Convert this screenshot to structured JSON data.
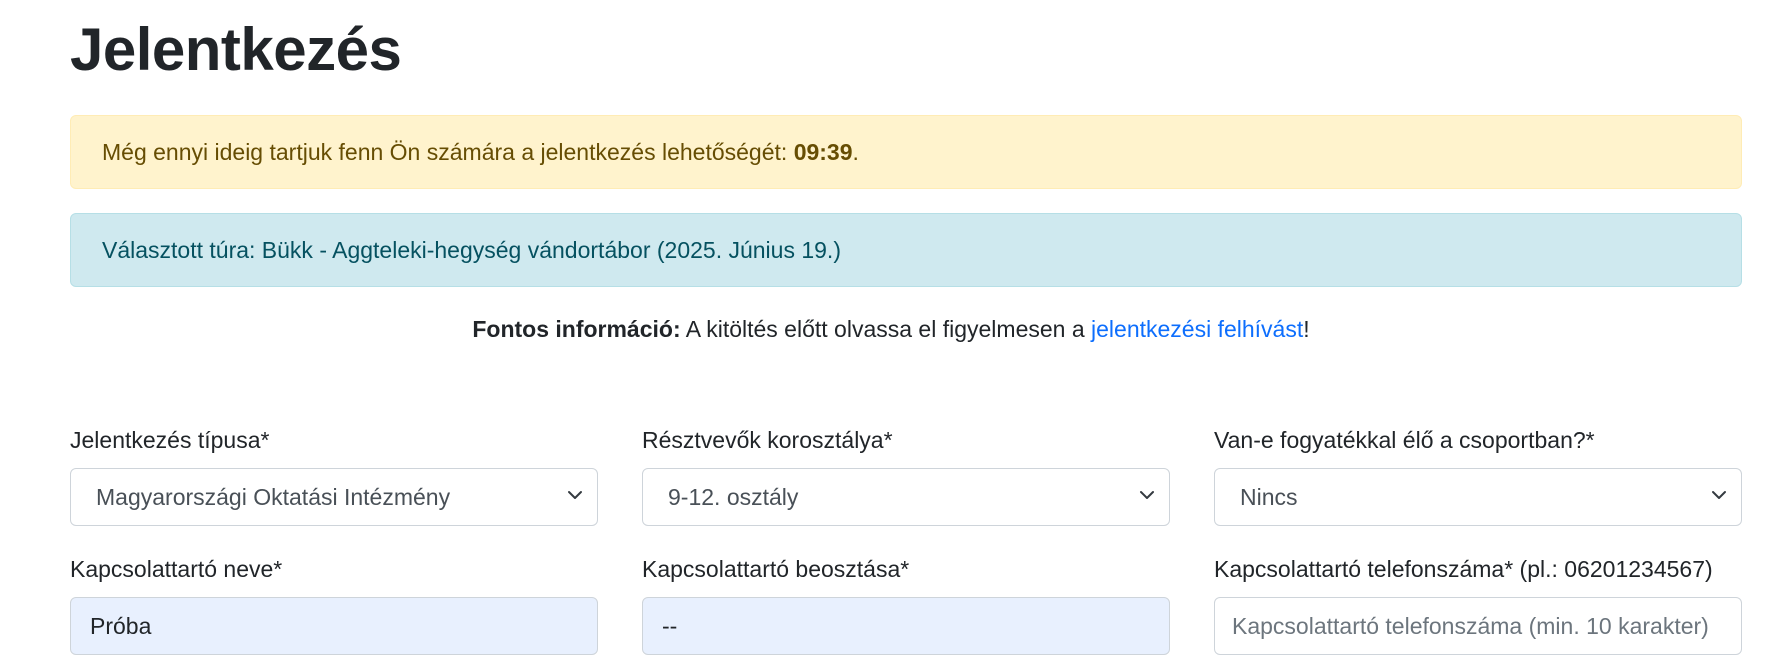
{
  "page": {
    "title": "Jelentkezés"
  },
  "alerts": {
    "timer_text": "Még ennyi ideig tartjuk fenn Ön számára a jelentkezés lehetőségét: ",
    "timer_value": "09:39",
    "timer_suffix": ".",
    "selected_tour": "Választott túra: Bükk - Aggteleki-hegység vándortábor (2025. Június 19.)"
  },
  "notice": {
    "bold": "Fontos információ:",
    "text": " A kitöltés előtt olvassa el figyelmesen a ",
    "link": "jelentkezési felhívást",
    "suffix": "!"
  },
  "form": {
    "application_type": {
      "label": "Jelentkezés típusa*",
      "value": "Magyarországi Oktatási Intézmény"
    },
    "age_group": {
      "label": "Résztvevők korosztálya*",
      "value": "9-12. osztály"
    },
    "disability": {
      "label": "Van-e fogyatékkal élő a csoportban?*",
      "value": "Nincs"
    },
    "contact_name": {
      "label": "Kapcsolattartó neve*",
      "value": "Próba"
    },
    "contact_position": {
      "label": "Kapcsolattartó beosztása*",
      "value": "--"
    },
    "contact_phone": {
      "label": "Kapcsolattartó telefonszáma* (pl.: 06201234567)",
      "placeholder": "Kapcsolattartó telefonszáma (min. 10 karakter)"
    }
  },
  "icons": {
    "select_arrow": "chevron-down-icon"
  },
  "colors": {
    "warning_bg": "#fff3cd",
    "info_bg": "#cfe9ef",
    "link": "#0d6efd",
    "autofill_bg": "#e8f0fe"
  }
}
